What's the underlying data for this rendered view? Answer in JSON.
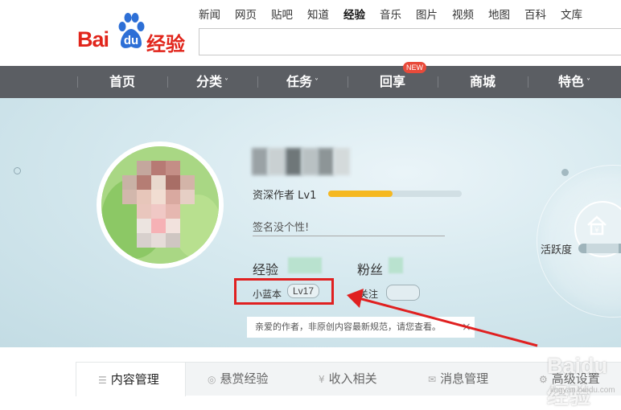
{
  "header": {
    "logo_text": "Bai",
    "logo_du": "du",
    "logo_product": "经验",
    "top_nav": [
      "新闻",
      "网页",
      "贴吧",
      "知道",
      "经验",
      "音乐",
      "图片",
      "视频",
      "地图",
      "百科",
      "文库"
    ],
    "top_nav_active": "经验",
    "search_value": ""
  },
  "main_nav": {
    "items": [
      {
        "label": "首页",
        "caret": ""
      },
      {
        "label": "分类",
        "caret": "˅"
      },
      {
        "label": "任务",
        "caret": "˅"
      },
      {
        "label": "回享",
        "caret": ""
      },
      {
        "label": "商城",
        "caret": ""
      },
      {
        "label": "特色",
        "caret": "˅"
      }
    ],
    "new_badge": "NEW"
  },
  "profile": {
    "rank": "资深作者 Lv1",
    "level_progress": 0.48,
    "signature_placeholder": "签名没个性!",
    "exp_label": "经验",
    "fans_label": "粉丝",
    "xiaolanben_label": "小蓝本",
    "xiaolanben_level": "Lv17",
    "follow_label": "关注",
    "activity_label": "活跃度",
    "notice_text": "亲爱的作者，非原创内容最新规范，请您查看。",
    "notice_close": "×"
  },
  "tabs": [
    {
      "label": "内容管理",
      "icon": "list-icon",
      "glyph": "☰",
      "active": true
    },
    {
      "label": "悬赏经验",
      "icon": "reward-icon",
      "glyph": "◎",
      "active": false
    },
    {
      "label": "收入相关",
      "icon": "yen-icon",
      "glyph": "¥",
      "active": false
    },
    {
      "label": "消息管理",
      "icon": "mail-icon",
      "glyph": "✉",
      "active": false
    },
    {
      "label": "高级设置",
      "icon": "gear-icon",
      "glyph": "⚙",
      "active": false
    }
  ],
  "watermark": {
    "text": "Baidu经验",
    "url": "jingyan.baidu.com"
  },
  "colors": {
    "brand_red": "#e1251b",
    "nav_bg": "#5b5e63",
    "progress_fill": "#f5b820",
    "highlight": "#e02020"
  }
}
